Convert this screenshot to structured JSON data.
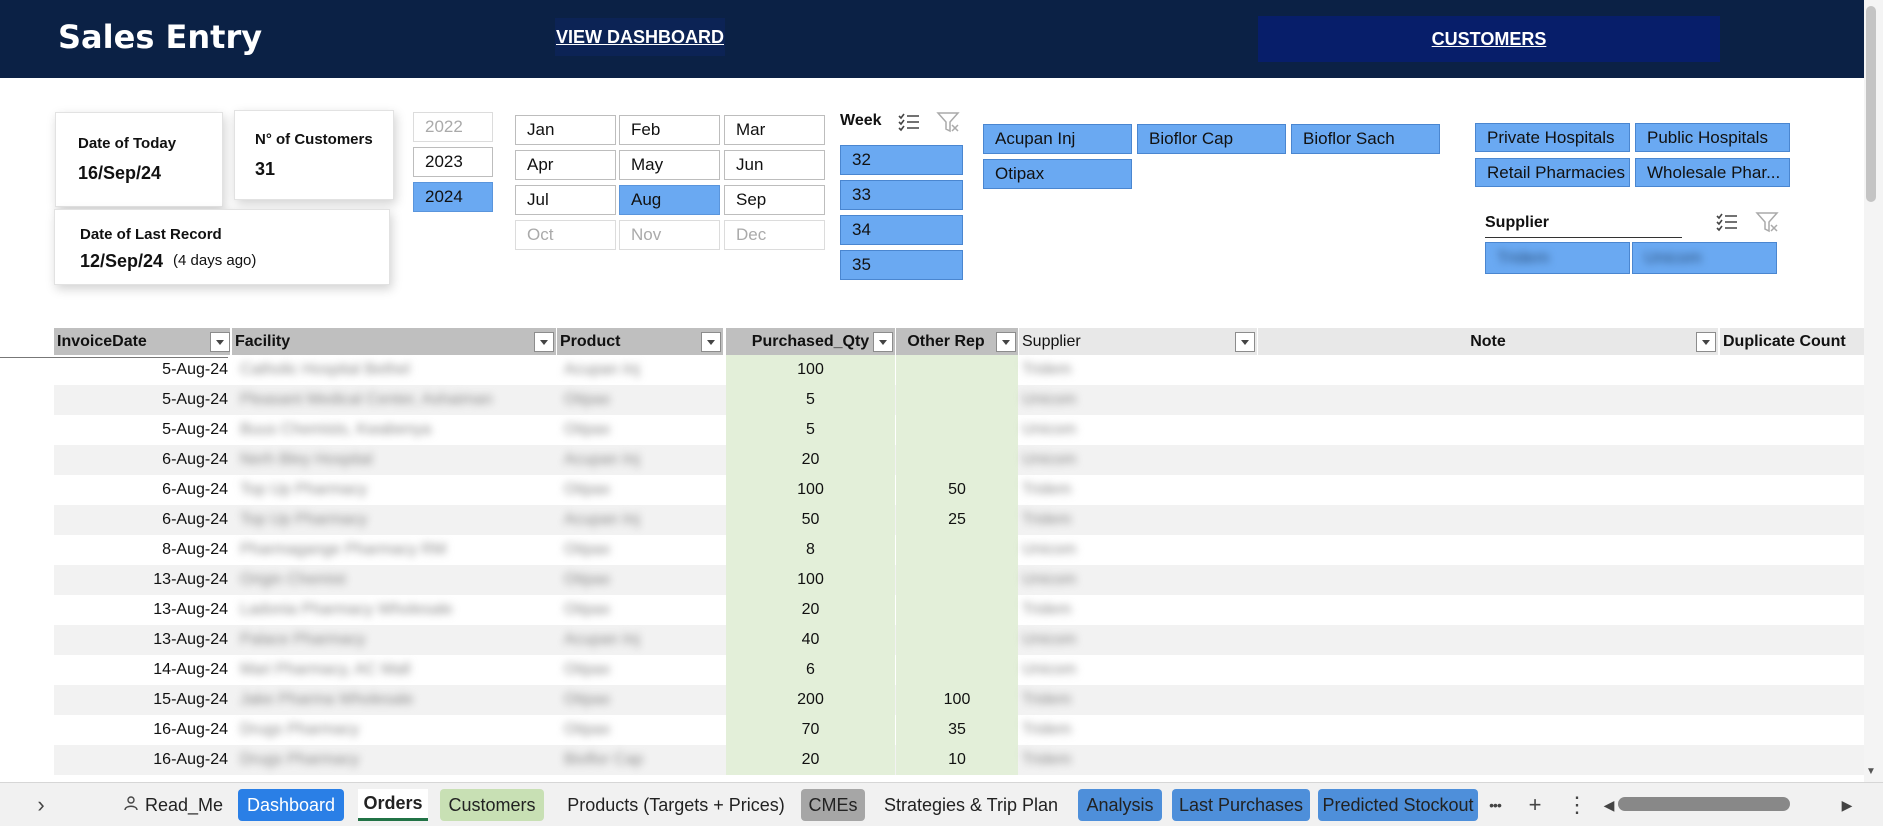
{
  "header": {
    "title": "Sales Entry",
    "view_dashboard": "VIEW DASHBOARD",
    "customers": "CUSTOMERS"
  },
  "cards": {
    "today_label": "Date of Today",
    "today_value": "16/Sep/24",
    "customers_label": "N° of Customers",
    "customers_value": "31",
    "last_label": "Date of Last Record",
    "last_value": "12/Sep/24",
    "last_ago": "(4 days ago)"
  },
  "years": [
    {
      "label": "2022",
      "state": "dim"
    },
    {
      "label": "2023",
      "state": "normal"
    },
    {
      "label": "2024",
      "state": "selected"
    }
  ],
  "months": [
    {
      "label": "Jan",
      "state": "normal"
    },
    {
      "label": "Feb",
      "state": "normal"
    },
    {
      "label": "Mar",
      "state": "normal"
    },
    {
      "label": "Apr",
      "state": "normal"
    },
    {
      "label": "May",
      "state": "normal"
    },
    {
      "label": "Jun",
      "state": "normal"
    },
    {
      "label": "Jul",
      "state": "normal"
    },
    {
      "label": "Aug",
      "state": "selected"
    },
    {
      "label": "Sep",
      "state": "normal"
    },
    {
      "label": "Oct",
      "state": "dim"
    },
    {
      "label": "Nov",
      "state": "dim"
    },
    {
      "label": "Dec",
      "state": "dim"
    }
  ],
  "week": {
    "header": "Week",
    "items": [
      "32",
      "33",
      "34",
      "35"
    ]
  },
  "products": [
    "Acupan Inj",
    "Bioflor Cap",
    "Bioflor Sach",
    "Otipax"
  ],
  "segments": [
    "Private Hospitals",
    "Public Hospitals",
    "Retail Pharmacies",
    "Wholesale Phar..."
  ],
  "supplier": {
    "header": "Supplier",
    "items": [
      "Tridem",
      "Unicom"
    ]
  },
  "table": {
    "headers": {
      "date": "InvoiceDate",
      "facility": "Facility",
      "product": "Product",
      "qty": "Purchased_Qty",
      "other": "Other Rep",
      "supplier": "Supplier",
      "note": "Note",
      "dup": "Duplicate Count"
    },
    "rows": [
      {
        "date": "5-Aug-24",
        "facility": "Catholic Hospital Bethel",
        "product": "Acupan Inj",
        "qty": "100",
        "other": "",
        "supplier": "Tridem"
      },
      {
        "date": "5-Aug-24",
        "facility": "Pleasant Medical Center, Ashaiman",
        "product": "Otipax",
        "qty": "5",
        "other": "",
        "supplier": "Unicom"
      },
      {
        "date": "5-Aug-24",
        "facility": "Buus Chemists, Kwabenya",
        "product": "Otipax",
        "qty": "5",
        "other": "",
        "supplier": "Unicom"
      },
      {
        "date": "6-Aug-24",
        "facility": "Nerh Bley Hospital",
        "product": "Acupan Inj",
        "qty": "20",
        "other": "",
        "supplier": "Unicom"
      },
      {
        "date": "6-Aug-24",
        "facility": "Top Up Pharmacy",
        "product": "Otipax",
        "qty": "100",
        "other": "50",
        "supplier": "Tridem"
      },
      {
        "date": "6-Aug-24",
        "facility": "Top Up Pharmacy",
        "product": "Acupan Inj",
        "qty": "50",
        "other": "25",
        "supplier": "Tridem"
      },
      {
        "date": "8-Aug-24",
        "facility": "Pharmagange Pharmacy RM",
        "product": "Otipax",
        "qty": "8",
        "other": "",
        "supplier": "Unicom"
      },
      {
        "date": "13-Aug-24",
        "facility": "Origin Chemist",
        "product": "Otipax",
        "qty": "100",
        "other": "",
        "supplier": "Unicom"
      },
      {
        "date": "13-Aug-24",
        "facility": "Ladonia Pharmacy Wholesale",
        "product": "Otipax",
        "qty": "20",
        "other": "",
        "supplier": "Tridem"
      },
      {
        "date": "13-Aug-24",
        "facility": "Palace Pharmacy",
        "product": "Acupan Inj",
        "qty": "40",
        "other": "",
        "supplier": "Unicom"
      },
      {
        "date": "14-Aug-24",
        "facility": "Mari Pharmacy, AC Mall",
        "product": "Otipax",
        "qty": "6",
        "other": "",
        "supplier": "Unicom"
      },
      {
        "date": "15-Aug-24",
        "facility": "Jake Pharma Wholesale",
        "product": "Otipax",
        "qty": "200",
        "other": "100",
        "supplier": "Tridem"
      },
      {
        "date": "16-Aug-24",
        "facility": "Drugs Pharmacy",
        "product": "Otipax",
        "qty": "70",
        "other": "35",
        "supplier": "Tridem"
      },
      {
        "date": "16-Aug-24",
        "facility": "Drugs Pharmacy",
        "product": "Bioflor Cap",
        "qty": "20",
        "other": "10",
        "supplier": "Tridem"
      }
    ]
  },
  "tabs": [
    {
      "label": "Read_Me",
      "style": "plain",
      "icon": "people-icon"
    },
    {
      "label": "Dashboard",
      "style": "dash"
    },
    {
      "label": "Orders",
      "style": "active"
    },
    {
      "label": "Customers",
      "style": "green"
    },
    {
      "label": "Products (Targets + Prices)",
      "style": "plain"
    },
    {
      "label": "CMEs",
      "style": "gray"
    },
    {
      "label": "Strategies & Trip Plan",
      "style": "plain"
    },
    {
      "label": "Analysis",
      "style": "blue"
    },
    {
      "label": "Last Purchases",
      "style": "blue"
    },
    {
      "label": "Predicted Stockout",
      "style": "blue"
    }
  ],
  "tabbar_glyphs": {
    "prev": "‹",
    "next": "›",
    "more": "•••",
    "add": "+",
    "menu": "⋮"
  },
  "colors": {
    "header": "#0b2145",
    "selected": "#6aa9f2",
    "qty_fill": "#e3efd9"
  }
}
